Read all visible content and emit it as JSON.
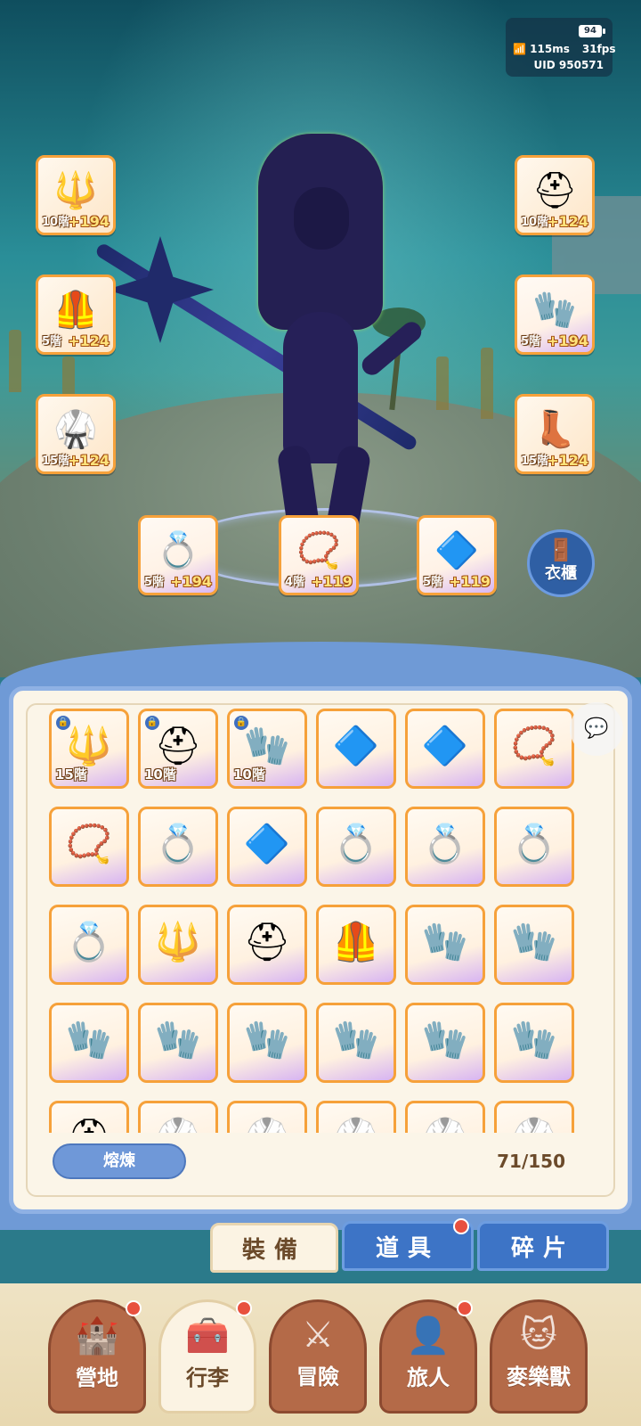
{
  "hud": {
    "battery": "94",
    "ping": "115ms",
    "fps": "31fps",
    "uid": "UID 950571"
  },
  "equipped": {
    "left": [
      {
        "icon": "halberd-icon",
        "glyph": "🔱",
        "tier": "10階",
        "plus": "+194",
        "rarity": "orange"
      },
      {
        "icon": "armor-icon",
        "glyph": "🦺",
        "tier": "5階",
        "plus": "+124",
        "rarity": "orange"
      },
      {
        "icon": "robe-icon",
        "glyph": "🥋",
        "tier": "15階",
        "plus": "+124",
        "rarity": "orange"
      }
    ],
    "right": [
      {
        "icon": "helmet-icon",
        "glyph": "⛑",
        "tier": "10階",
        "plus": "+124",
        "rarity": "orange"
      },
      {
        "icon": "gauntlet-icon",
        "glyph": "🧤",
        "tier": "5階",
        "plus": "+194",
        "rarity": "purple"
      },
      {
        "icon": "boots-icon",
        "glyph": "👢",
        "tier": "15階",
        "plus": "+124",
        "rarity": "orange"
      }
    ],
    "bottom": [
      {
        "icon": "ring-icon",
        "glyph": "💍",
        "tier": "5階",
        "plus": "+194",
        "rarity": "purple"
      },
      {
        "icon": "necklace-icon",
        "glyph": "📿",
        "tier": "4階",
        "plus": "+119",
        "rarity": "purple"
      },
      {
        "icon": "amulet-icon",
        "glyph": "🔷",
        "tier": "5階",
        "plus": "+119",
        "rarity": "purple"
      }
    ]
  },
  "wardrobe": {
    "label": "衣櫃"
  },
  "inventory": {
    "items": [
      {
        "icon": "halberd-icon",
        "glyph": "🔱",
        "tier": "15階",
        "locked": true
      },
      {
        "icon": "helmet-icon",
        "glyph": "⛑",
        "tier": "10階",
        "locked": true
      },
      {
        "icon": "gauntlet-icon",
        "glyph": "🧤",
        "tier": "10階",
        "locked": true
      },
      {
        "icon": "amulet-icon",
        "glyph": "🔷",
        "tier": "",
        "locked": false
      },
      {
        "icon": "amulet-icon",
        "glyph": "🔷",
        "tier": "",
        "locked": false
      },
      {
        "icon": "necklace-icon",
        "glyph": "📿",
        "tier": "",
        "locked": false
      },
      {
        "icon": "necklace-icon",
        "glyph": "📿",
        "tier": "",
        "locked": false
      },
      {
        "icon": "ring-icon",
        "glyph": "💍",
        "tier": "",
        "locked": false
      },
      {
        "icon": "amulet-icon",
        "glyph": "🔷",
        "tier": "",
        "locked": false
      },
      {
        "icon": "ring-icon",
        "glyph": "💍",
        "tier": "",
        "locked": false
      },
      {
        "icon": "ring-icon",
        "glyph": "💍",
        "tier": "",
        "locked": false
      },
      {
        "icon": "ring-icon",
        "glyph": "💍",
        "tier": "",
        "locked": false
      },
      {
        "icon": "ring-icon",
        "glyph": "💍",
        "tier": "",
        "locked": false
      },
      {
        "icon": "halberd-icon",
        "glyph": "🔱",
        "tier": "",
        "locked": false
      },
      {
        "icon": "helmet-icon",
        "glyph": "⛑",
        "tier": "",
        "locked": false
      },
      {
        "icon": "armor-icon",
        "glyph": "🦺",
        "tier": "",
        "locked": false
      },
      {
        "icon": "gauntlet-icon",
        "glyph": "🧤",
        "tier": "",
        "locked": false
      },
      {
        "icon": "gauntlet-icon",
        "glyph": "🧤",
        "tier": "",
        "locked": false
      },
      {
        "icon": "gauntlet-icon",
        "glyph": "🧤",
        "tier": "",
        "locked": false
      },
      {
        "icon": "gauntlet-icon",
        "glyph": "🧤",
        "tier": "",
        "locked": false
      },
      {
        "icon": "gauntlet-icon",
        "glyph": "🧤",
        "tier": "",
        "locked": false
      },
      {
        "icon": "gauntlet-icon",
        "glyph": "🧤",
        "tier": "",
        "locked": false
      },
      {
        "icon": "gauntlet-icon",
        "glyph": "🧤",
        "tier": "",
        "locked": false
      },
      {
        "icon": "gauntlet-icon",
        "glyph": "🧤",
        "tier": "",
        "locked": false
      },
      {
        "icon": "helmet-icon",
        "glyph": "⛑",
        "tier": "",
        "locked": false
      },
      {
        "icon": "robe-icon",
        "glyph": "🥋",
        "tier": "",
        "locked": false
      },
      {
        "icon": "robe-icon",
        "glyph": "🥋",
        "tier": "",
        "locked": false
      },
      {
        "icon": "robe-icon",
        "glyph": "🥋",
        "tier": "",
        "locked": false
      },
      {
        "icon": "robe-icon",
        "glyph": "🥋",
        "tier": "",
        "locked": false
      },
      {
        "icon": "robe-icon",
        "glyph": "🥋",
        "tier": "",
        "locked": false
      }
    ],
    "smelt_label": "熔煉",
    "capacity": "71/150"
  },
  "tabs": {
    "equipment": "裝備",
    "items": "道具",
    "shards": "碎片"
  },
  "nav": [
    {
      "icon": "castle-icon",
      "glyph": "🏰",
      "label": "營地",
      "active": false,
      "badge": true
    },
    {
      "icon": "chest-icon",
      "glyph": "🧰",
      "label": "行李",
      "active": true,
      "badge": true
    },
    {
      "icon": "swords-icon",
      "glyph": "⚔",
      "label": "冒險",
      "active": false,
      "badge": false
    },
    {
      "icon": "traveler-icon",
      "glyph": "👤",
      "label": "旅人",
      "active": false,
      "badge": true
    },
    {
      "icon": "cat-icon",
      "glyph": "🐱",
      "label": "麥樂獸",
      "active": false,
      "badge": false
    }
  ],
  "colors": {
    "accent_orange": "#f6a13a",
    "panel_blue": "#6f9ad6",
    "badge_red": "#e8503e",
    "text_brown": "#6b4a2a"
  }
}
